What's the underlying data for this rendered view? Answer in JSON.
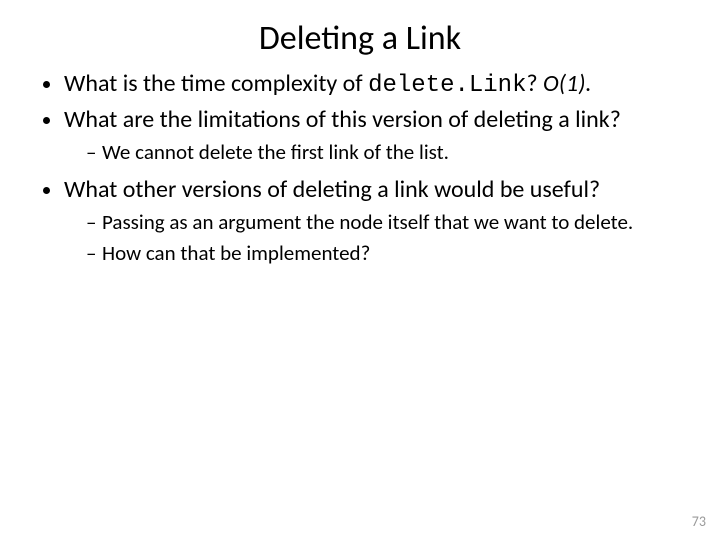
{
  "title": "Deleting a Link",
  "bullets": {
    "b1_pre": "What is the time complexity of ",
    "b1_code": "delete.Link",
    "b1_post": "? ",
    "b1_ital": "O(1).",
    "b2": "What are the limitations of this version of deleting a link?",
    "b2_sub1": "We cannot delete the first link of the list.",
    "b3": "What other versions of deleting a link would be useful?",
    "b3_sub1": "Passing as an argument the node itself that we want to delete.",
    "b3_sub2": "How can that be implemented?"
  },
  "page_number": "73"
}
